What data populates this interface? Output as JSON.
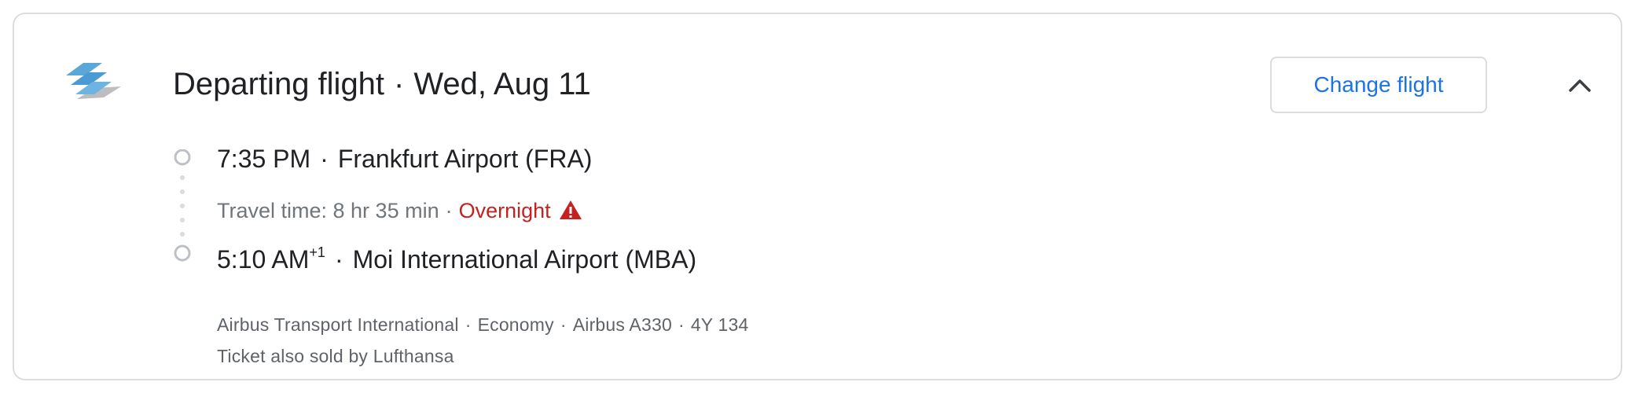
{
  "header": {
    "title": "Departing flight",
    "separator": "·",
    "date": "Wed, Aug 11",
    "change_button": "Change flight",
    "collapse_icon": "chevron-up-icon",
    "airline_logo_icon": "airline-logo-icon"
  },
  "departure": {
    "time": "7:35 PM",
    "separator": "·",
    "airport": "Frankfurt Airport (FRA)"
  },
  "travel": {
    "label": "Travel time: 8 hr 35 min",
    "separator": "·",
    "overnight": "Overnight",
    "warning_icon": "warning-icon",
    "overnight_color": "#c5221f"
  },
  "arrival": {
    "time": "5:10 AM",
    "day_offset": "+1",
    "separator": "·",
    "airport": "Moi International Airport (MBA)"
  },
  "details": {
    "operator": "Airbus Transport International",
    "cabin": "Economy",
    "aircraft": "Airbus A330",
    "flight_number": "4Y 134",
    "separator": "·",
    "sold_by": "Ticket also sold by Lufthansa"
  },
  "colors": {
    "accent": "#1a73e8",
    "border": "#dadce0",
    "secondary_text": "#70757a",
    "warning": "#c5221f"
  }
}
